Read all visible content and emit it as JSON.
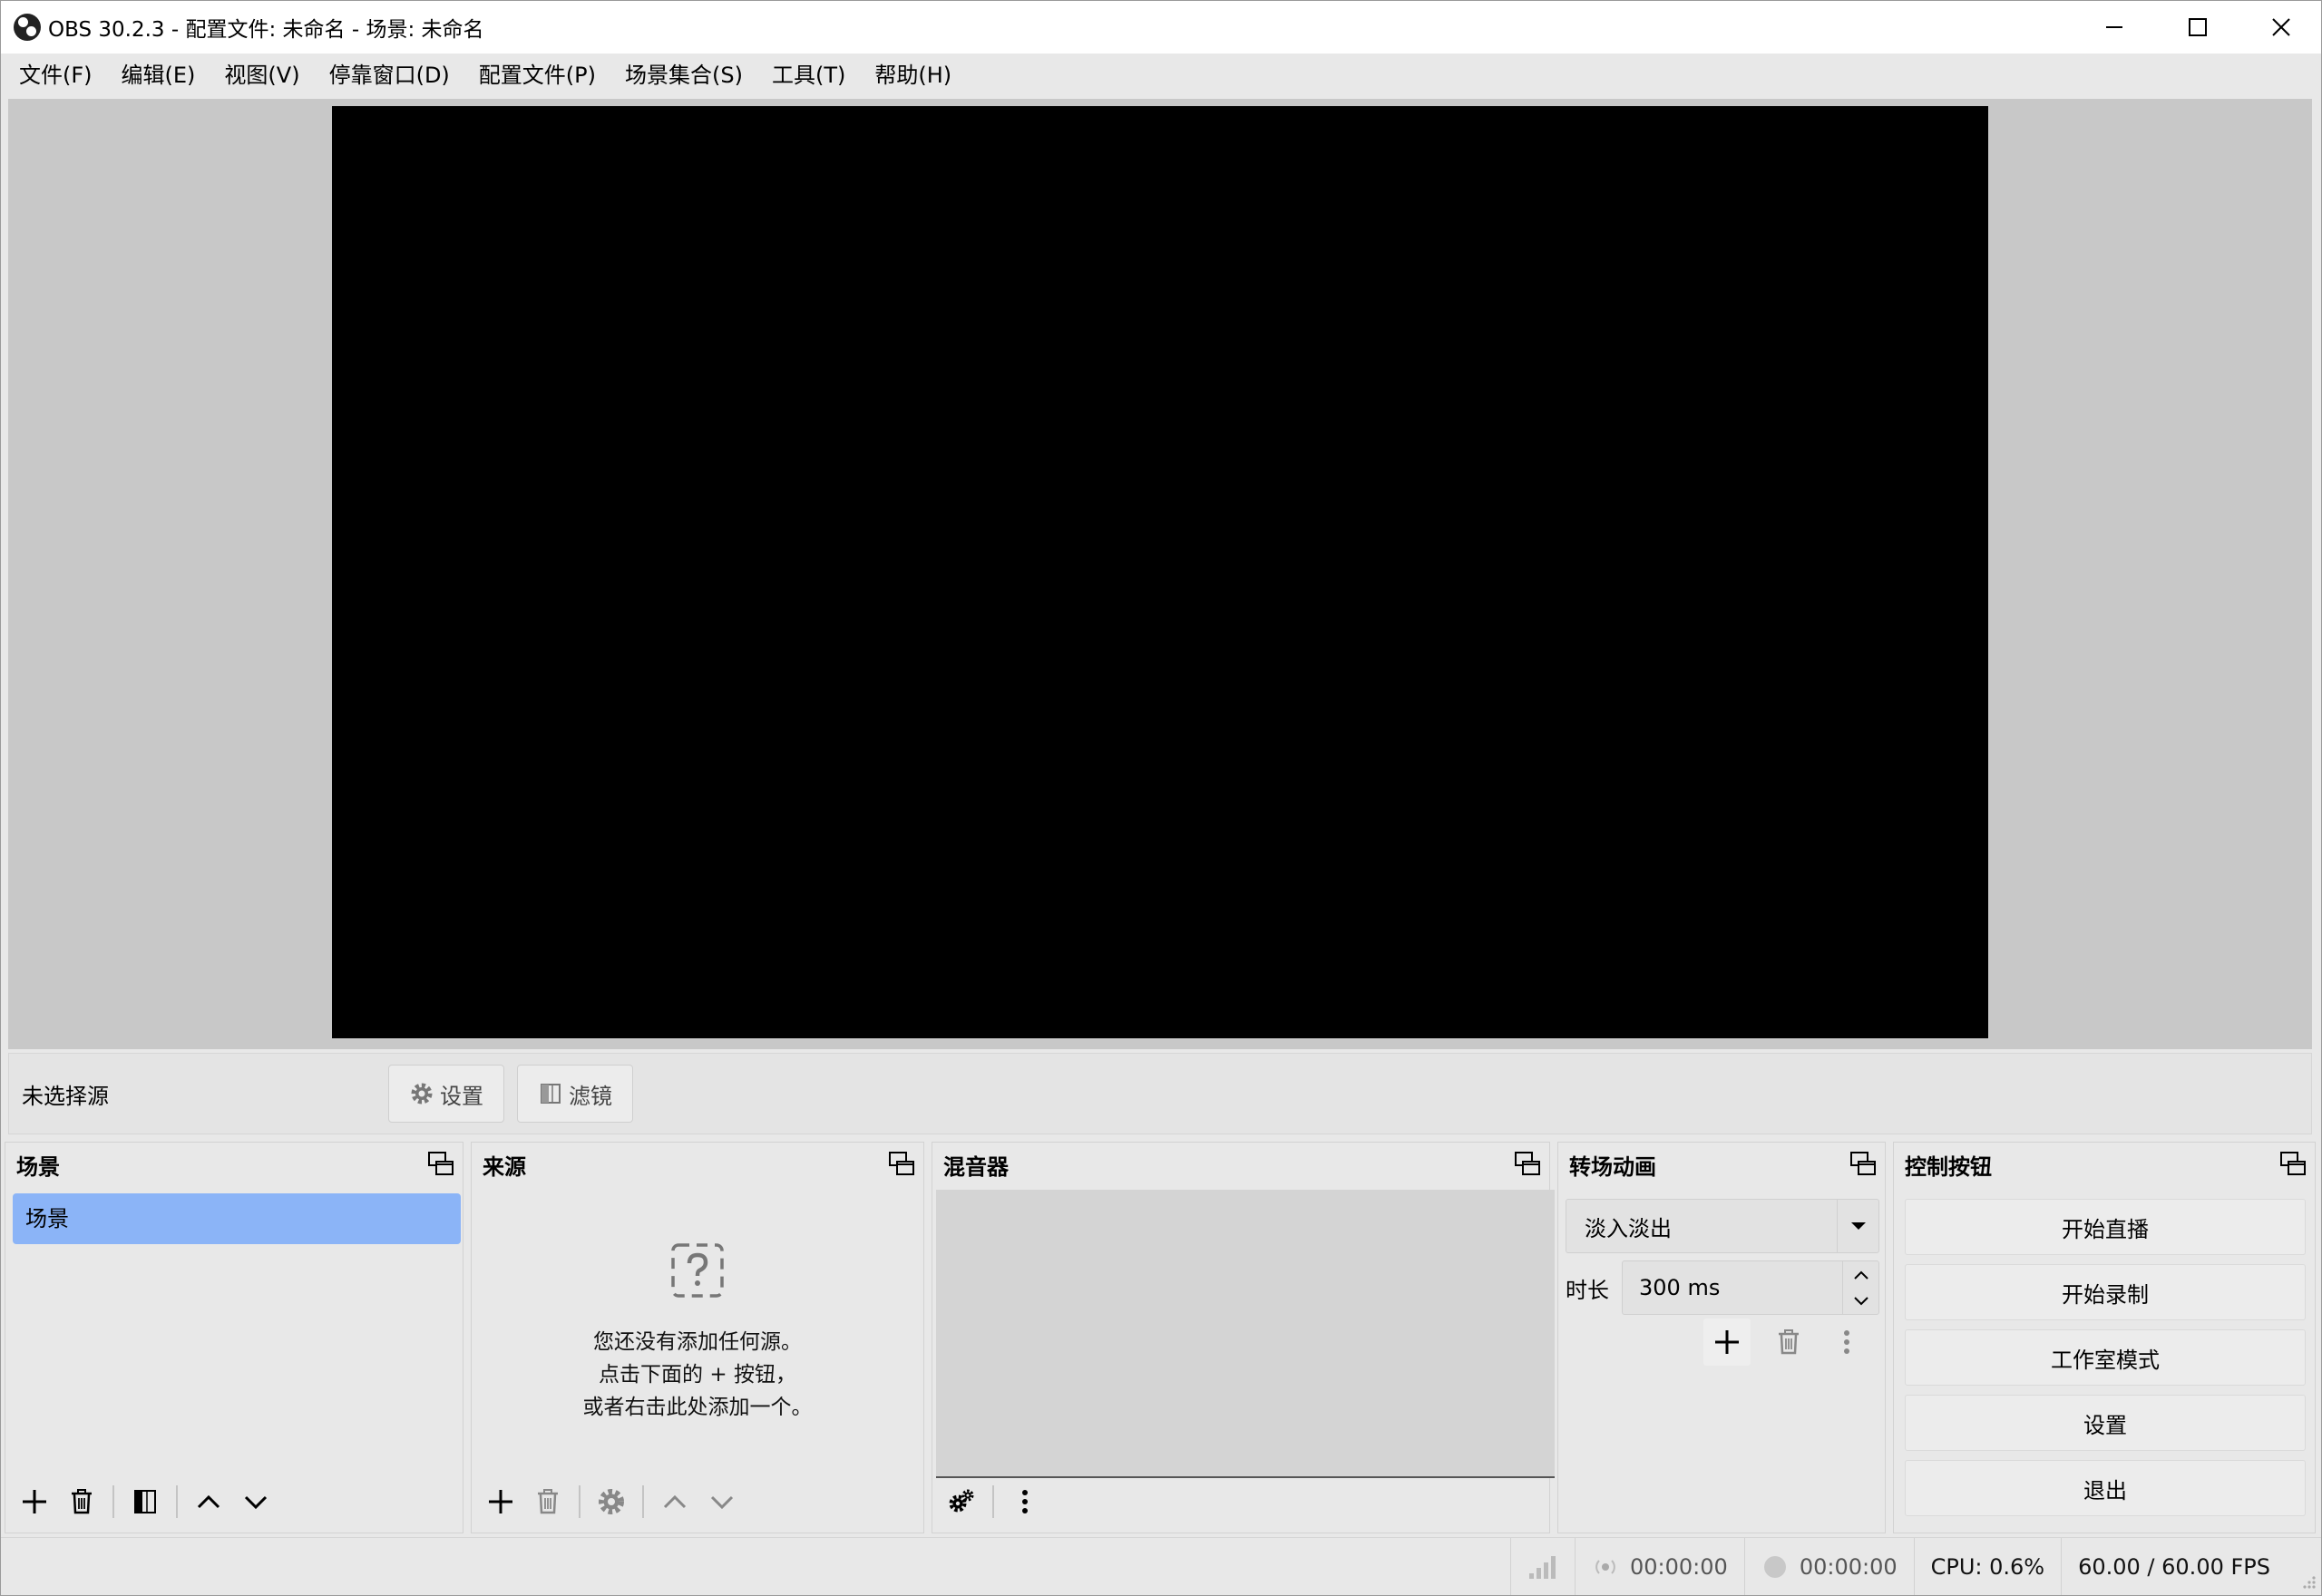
{
  "window": {
    "title": "OBS 30.2.3 - 配置文件: 未命名 - 场景: 未命名"
  },
  "menu": [
    {
      "label": "文件(F)"
    },
    {
      "label": "编辑(E)"
    },
    {
      "label": "视图(V)"
    },
    {
      "label": "停靠窗口(D)"
    },
    {
      "label": "配置文件(P)"
    },
    {
      "label": "场景集合(S)"
    },
    {
      "label": "工具(T)"
    },
    {
      "label": "帮助(H)"
    }
  ],
  "source_toolbar": {
    "no_source": "未选择源",
    "settings_label": "设置",
    "filters_label": "滤镜"
  },
  "scenes": {
    "title": "场景",
    "items": [
      {
        "label": "场景",
        "selected": true
      }
    ]
  },
  "sources": {
    "title": "来源",
    "empty_lines": [
      "您还没有添加任何源。",
      "点击下面的 + 按钮，",
      "或者右击此处添加一个。"
    ]
  },
  "mixer": {
    "title": "混音器"
  },
  "transitions": {
    "title": "转场动画",
    "selected": "淡入淡出",
    "duration_label": "时长",
    "duration_value": "300 ms"
  },
  "controls": {
    "title": "控制按钮",
    "buttons": [
      {
        "label": "开始直播"
      },
      {
        "label": "开始录制"
      },
      {
        "label": "工作室模式"
      },
      {
        "label": "设置"
      },
      {
        "label": "退出"
      }
    ]
  },
  "status": {
    "stream_time": "00:00:00",
    "record_time": "00:00:00",
    "cpu": "CPU: 0.6%",
    "fps": "60.00 / 60.00 FPS"
  },
  "colors": {
    "selected_scene": "#8bb4f7",
    "preview_bg": "#000000",
    "chrome_bg": "#e8e8e8"
  }
}
